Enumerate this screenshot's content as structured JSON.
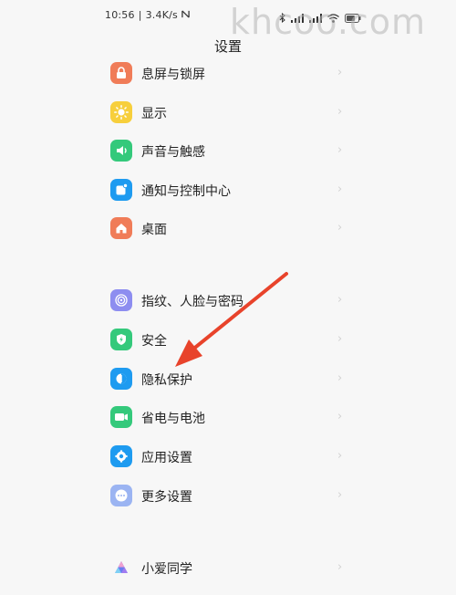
{
  "status_bar": {
    "time": "10:56",
    "speed": "3.4K/s"
  },
  "watermark": "khcoo.com",
  "page": {
    "title": "设置"
  },
  "groups": [
    {
      "items": [
        {
          "id": "lockscreen",
          "label": "息屏与锁屏",
          "icon": "lock-screen-icon",
          "color": "#f07c58"
        },
        {
          "id": "display",
          "label": "显示",
          "icon": "sun-icon",
          "color": "#f7cf3c"
        },
        {
          "id": "sound",
          "label": "声音与触感",
          "icon": "speaker-icon",
          "color": "#34c97b"
        },
        {
          "id": "notifications",
          "label": "通知与控制中心",
          "icon": "notification-icon",
          "color": "#1e9bf0"
        },
        {
          "id": "desktop",
          "label": "桌面",
          "icon": "home-icon",
          "color": "#f07c58"
        }
      ]
    },
    {
      "items": [
        {
          "id": "fingerprint",
          "label": "指纹、人脸与密码",
          "icon": "fingerprint-icon",
          "color": "#8d8df0"
        },
        {
          "id": "security",
          "label": "安全",
          "icon": "shield-icon",
          "color": "#34c97b"
        },
        {
          "id": "privacy",
          "label": "隐私保护",
          "icon": "privacy-icon",
          "color": "#1e9bf0"
        },
        {
          "id": "battery",
          "label": "省电与电池",
          "icon": "battery-icon",
          "color": "#34c97b"
        },
        {
          "id": "apps",
          "label": "应用设置",
          "icon": "gear-icon",
          "color": "#1e9bf0"
        },
        {
          "id": "more",
          "label": "更多设置",
          "icon": "more-icon",
          "color": "#9bb4f2"
        }
      ]
    },
    {
      "items": [
        {
          "id": "xiaoai",
          "label": "小爱同学",
          "icon": "xiaoai-icon",
          "color": "#6a7cf0"
        }
      ]
    }
  ],
  "annotation_arrow": {
    "color": "#e8432b"
  }
}
